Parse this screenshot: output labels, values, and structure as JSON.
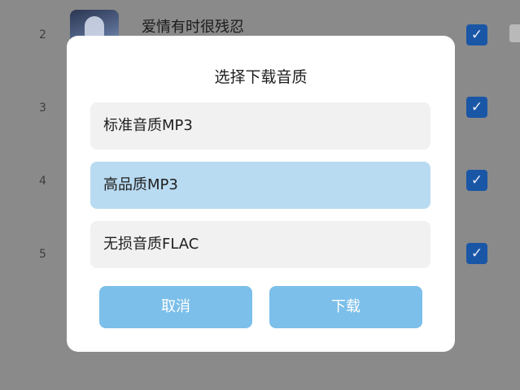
{
  "list": {
    "items": [
      {
        "index": "2",
        "title": "爱情有时很残忍",
        "checked": true
      },
      {
        "index": "3",
        "title": "",
        "checked": true
      },
      {
        "index": "4",
        "title": "",
        "checked": true
      },
      {
        "index": "5",
        "title": "",
        "checked": true
      }
    ],
    "check_glyph": "✓",
    "check_color": "#1a56a6"
  },
  "dialog": {
    "title": "选择下载音质",
    "options": [
      {
        "label": "标准音质MP3",
        "selected": false
      },
      {
        "label": "高品质MP3",
        "selected": true
      },
      {
        "label": "无损音质FLAC",
        "selected": false
      }
    ],
    "cancel_label": "取消",
    "download_label": "下载",
    "button_color": "#7cbfea",
    "selected_color": "#b9dbf1"
  }
}
